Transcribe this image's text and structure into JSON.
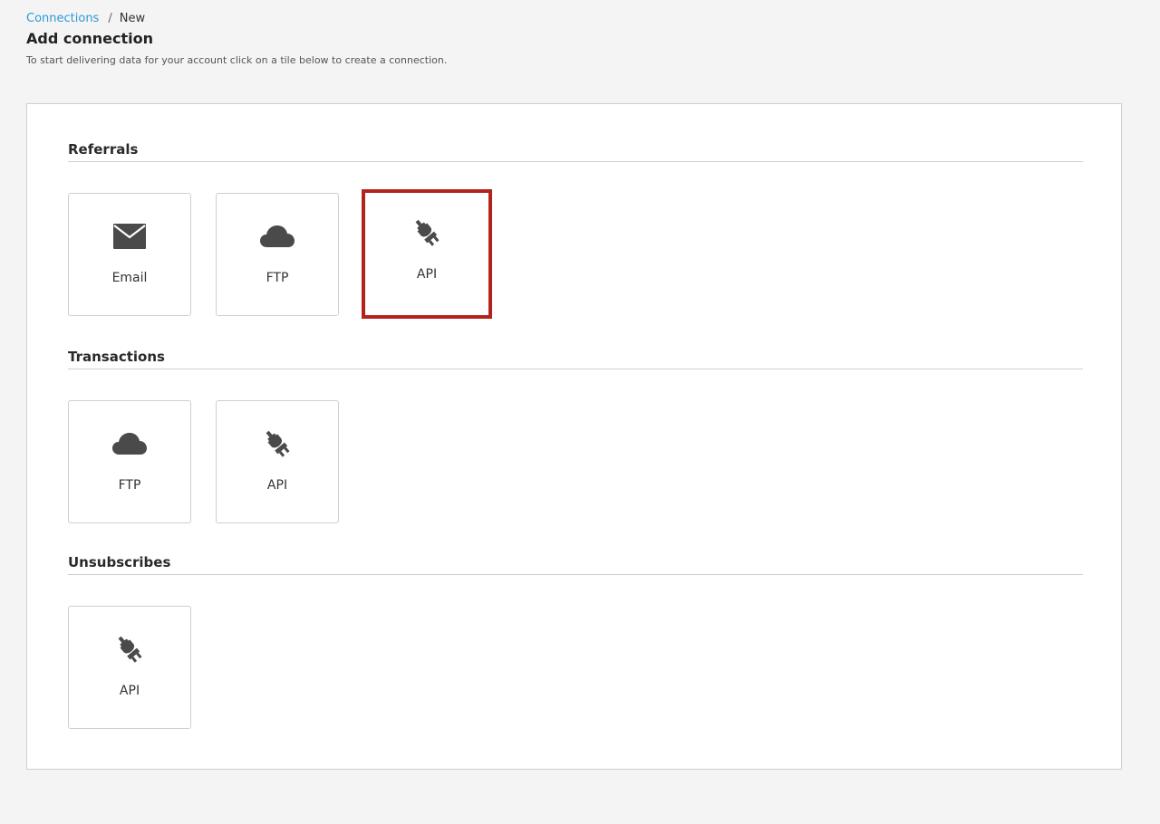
{
  "breadcrumb": {
    "link": "Connections",
    "separator": "/",
    "current": "New"
  },
  "page": {
    "title": "Add connection",
    "subtitle": "To start delivering data for your account click on a tile below to create a connection."
  },
  "colors": {
    "link": "#2a9ad8",
    "highlight": "#b3231c",
    "icon": "#4a4a4a"
  },
  "sections": [
    {
      "title": "Referrals",
      "tiles": [
        {
          "label": "Email",
          "icon": "envelope-icon"
        },
        {
          "label": "FTP",
          "icon": "cloud-icon"
        },
        {
          "label": "API",
          "icon": "plug-icon",
          "highlighted": true
        }
      ]
    },
    {
      "title": "Transactions",
      "tiles": [
        {
          "label": "FTP",
          "icon": "cloud-icon"
        },
        {
          "label": "API",
          "icon": "plug-icon"
        }
      ]
    },
    {
      "title": "Unsubscribes",
      "tiles": [
        {
          "label": "API",
          "icon": "plug-icon"
        }
      ]
    }
  ]
}
